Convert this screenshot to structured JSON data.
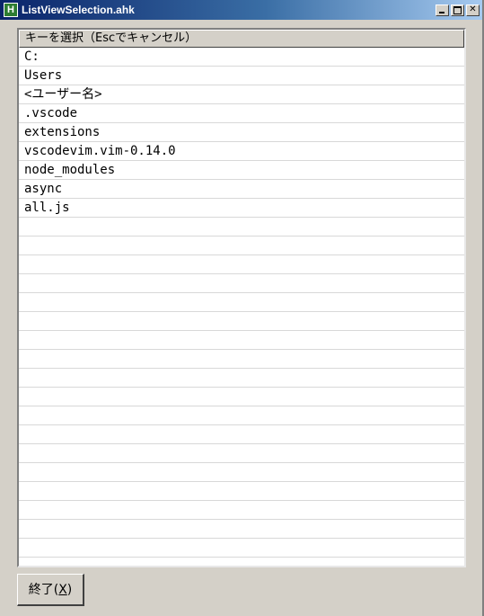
{
  "window": {
    "title": "ListViewSelection.ahk",
    "app_icon_glyph": "H",
    "close_glyph": "✕"
  },
  "listview": {
    "header": "キーを選択（Escでキャンセル）",
    "items": [
      "C:",
      "Users",
      "<ユーザー名>",
      ".vscode",
      "extensions",
      "vscodevim.vim-0.14.0",
      "node_modules",
      "async",
      "all.js"
    ]
  },
  "footer": {
    "exit_button_prefix": "終了(",
    "exit_button_accel": "X",
    "exit_button_suffix": ")"
  },
  "colors": {
    "titlebar_start": "#0a246a",
    "titlebar_end": "#a6caf0",
    "window_bg": "#d4d0c8"
  }
}
